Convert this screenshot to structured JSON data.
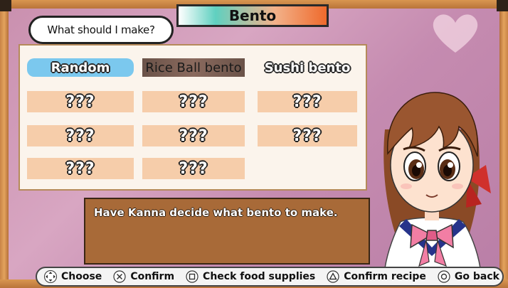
{
  "title": "Bento",
  "question": "What should I make?",
  "menu": {
    "headers": [
      "Random",
      "Rice Ball bento",
      "Sushi bento"
    ],
    "rows": [
      [
        "???",
        "???",
        "???"
      ],
      [
        "???",
        "???",
        "???"
      ],
      [
        "???",
        "???",
        ""
      ]
    ]
  },
  "description": "Have Kanna decide what bento to make.",
  "controls": [
    {
      "icon": "dpad-icon",
      "label": "Choose"
    },
    {
      "icon": "cross-button-icon",
      "label": "Confirm"
    },
    {
      "icon": "square-button-icon",
      "label": "Check food supplies"
    },
    {
      "icon": "triangle-button-icon",
      "label": "Confirm recipe"
    },
    {
      "icon": "circle-button-icon",
      "label": "Go back"
    }
  ],
  "colors": {
    "selected": "#7bc8ee",
    "cell": "#f6cdaa",
    "desc_bg": "#a86a38"
  }
}
